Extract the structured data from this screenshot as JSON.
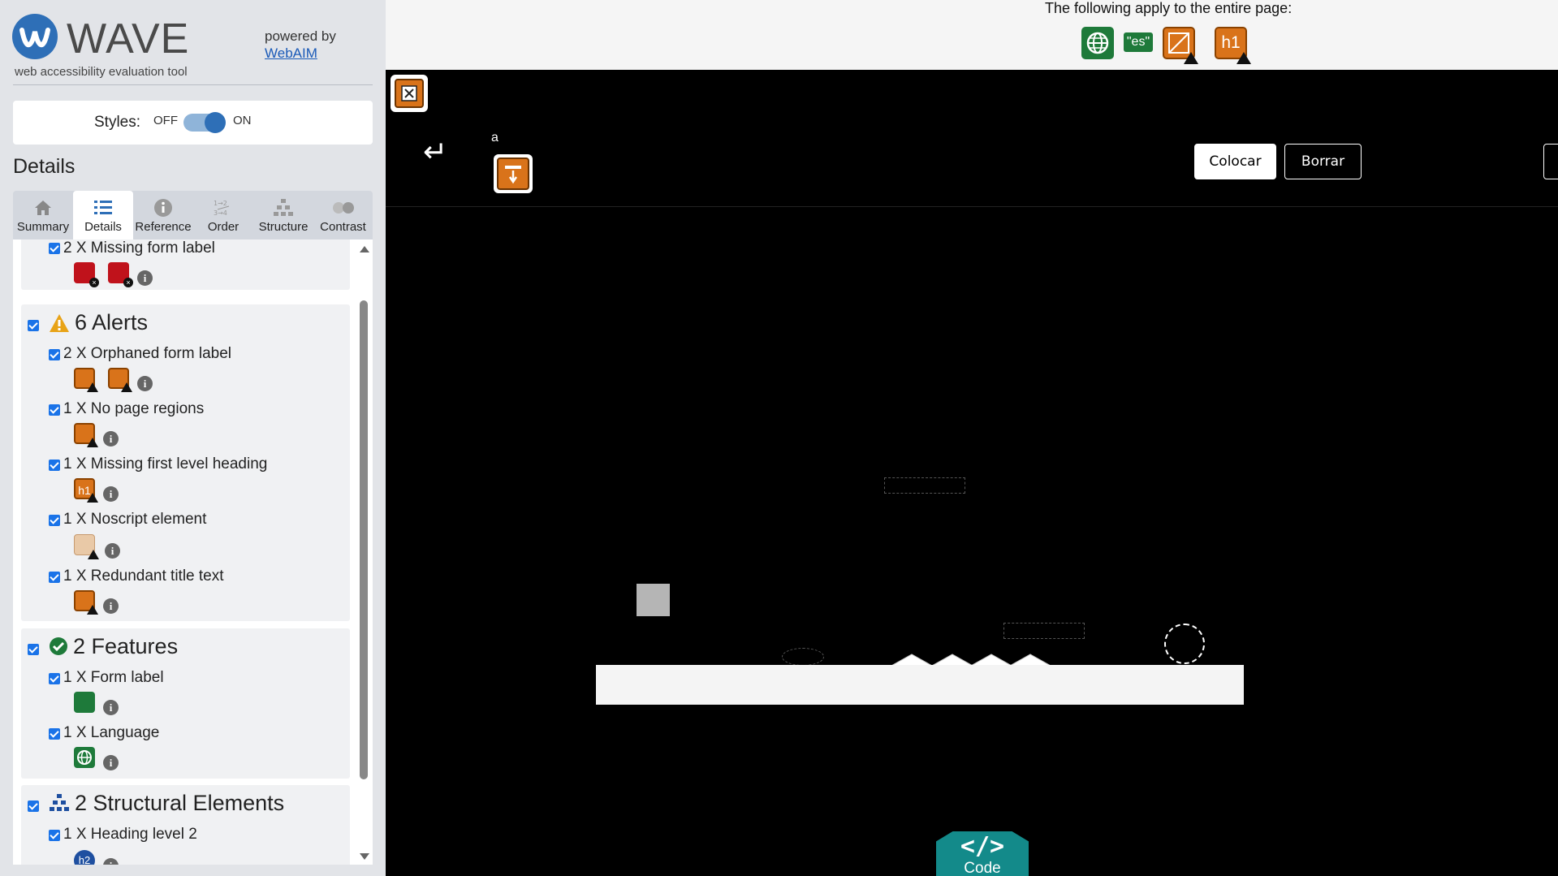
{
  "sidebar": {
    "brand": "WAVE",
    "subtitle": "web accessibility evaluation tool",
    "powered_by": "powered by",
    "powered_link": "WebAIM",
    "styles_label": "Styles:",
    "styles_off": "OFF",
    "styles_on": "ON",
    "details_heading": "Details",
    "tabs": [
      {
        "label": "Summary",
        "icon": "home-icon"
      },
      {
        "label": "Details",
        "icon": "list-icon",
        "active": true
      },
      {
        "label": "Reference",
        "icon": "info-icon"
      },
      {
        "label": "Order",
        "icon": "order-icon"
      },
      {
        "label": "Structure",
        "icon": "structure-icon"
      },
      {
        "label": "Contrast",
        "icon": "contrast-icon"
      }
    ],
    "errors_partial": {
      "item": "2 X Missing form label"
    },
    "alerts": {
      "title": "6 Alerts",
      "items": [
        "2 X Orphaned form label",
        "1 X No page regions",
        "1 X Missing first level heading",
        "1 X Noscript element",
        "1 X Redundant title text"
      ]
    },
    "features": {
      "title": "2 Features",
      "items": [
        "1 X Form label",
        "1 X Language"
      ]
    },
    "structural": {
      "title": "2 Structural Elements",
      "items": [
        "1 X Heading level 2"
      ],
      "h2_icon_text": "h2"
    },
    "info_glyph": "i"
  },
  "topbar": {
    "apply_text": "The following apply to the entire page:",
    "lang_badge": "\"es\"",
    "h1_badge": "h1"
  },
  "stage": {
    "back_glyph": "↵",
    "tiny_text": "a",
    "colocar": "Colocar",
    "borrar": "Borrar",
    "code_glyph": "</>",
    "code_label": "Code"
  },
  "colors": {
    "error": "#c0121b",
    "alert": "#d9731a",
    "feature": "#1e7a3a",
    "structure": "#1e4fa0",
    "accent": "#2e6fb7",
    "code_tab": "#138a8a"
  }
}
